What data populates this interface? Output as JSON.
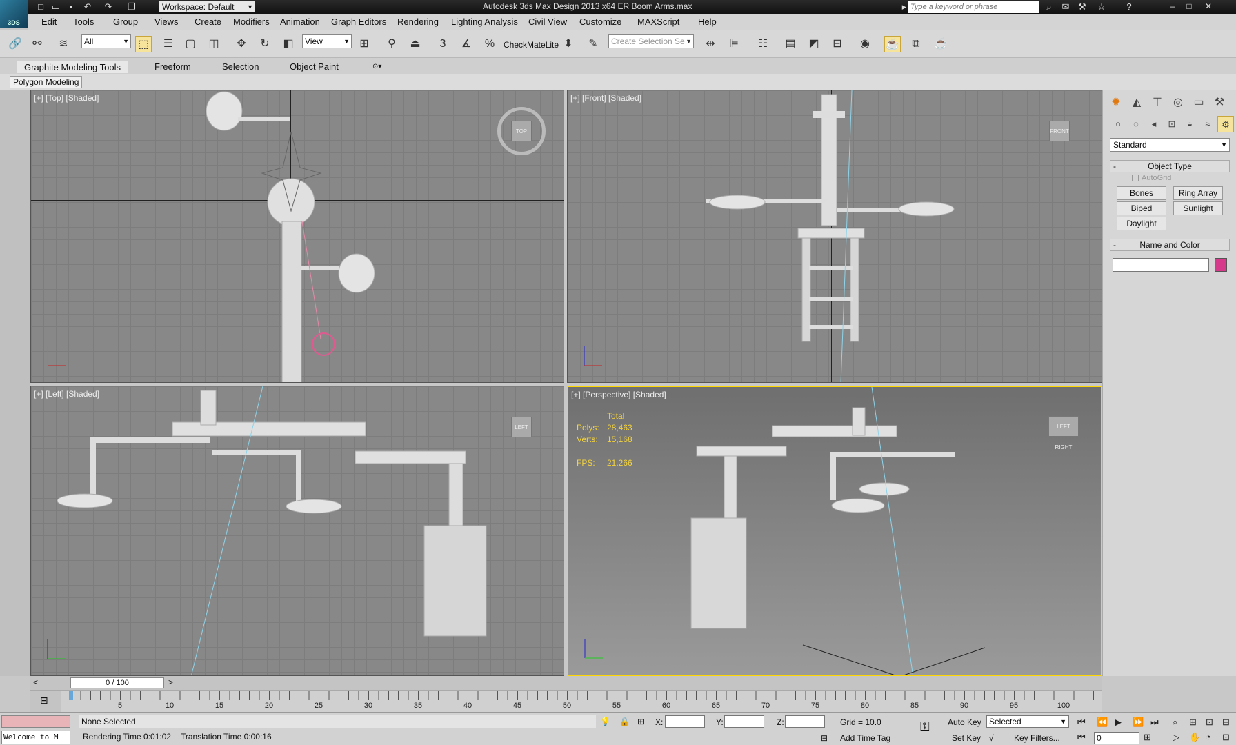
{
  "title_bar": {
    "workspace": "Workspace: Default",
    "window_title": "Autodesk 3ds Max Design 2013 x64     ER Boom Arms.max",
    "search_placeholder": "Type a keyword or phrase",
    "app_logo": "3DS"
  },
  "menu": [
    "Edit",
    "Tools",
    "Group",
    "Views",
    "Create",
    "Modifiers",
    "Animation",
    "Graph Editors",
    "Rendering",
    "Lighting Analysis",
    "Civil View",
    "Customize",
    "MAXScript",
    "Help"
  ],
  "toolbar": {
    "selection_filter": "All",
    "reference_coord": "View",
    "snap_value": "3",
    "checkmate": "CheckMateLite",
    "selection_set_placeholder": "Create Selection Se"
  },
  "ribbon": {
    "tabs": [
      "Graphite Modeling Tools",
      "Freeform",
      "Selection",
      "Object Paint"
    ],
    "panel": "Polygon Modeling"
  },
  "viewports": {
    "top": {
      "label": "[+] [Top] [Shaded]",
      "cube": "TOP"
    },
    "front": {
      "label": "[+] [Front] [Shaded]",
      "cube": "FRONT"
    },
    "left": {
      "label": "[+] [Left] [Shaded]",
      "cube": "LEFT"
    },
    "perspective": {
      "label": "[+] [Perspective] [Shaded]",
      "cube": "LEFT  RIGHT",
      "stats": {
        "header": "Total",
        "polys_label": "Polys:",
        "polys": "28,463",
        "verts_label": "Verts:",
        "verts": "15,168",
        "fps_label": "FPS:",
        "fps": "21.266"
      }
    }
  },
  "command_panel": {
    "dropdown": "Standard",
    "object_type": "Object Type",
    "autogrid": "AutoGrid",
    "buttons": [
      "Bones",
      "Ring Array",
      "Biped",
      "Sunlight",
      "Daylight"
    ],
    "name_and_color": "Name and Color",
    "swatch_color": "#d63a8a"
  },
  "timeline": {
    "position": "0 / 100",
    "ticks": [
      "5",
      "10",
      "15",
      "20",
      "25",
      "30",
      "35",
      "40",
      "45",
      "50",
      "55",
      "60",
      "65",
      "70",
      "75",
      "80",
      "85",
      "90",
      "95",
      "100"
    ]
  },
  "status": {
    "selection": "None Selected",
    "rendering_time": "Rendering Time  0:01:02",
    "translation_time": "Translation Time  0:00:16",
    "x_label": "X:",
    "y_label": "Y:",
    "z_label": "Z:",
    "grid": "Grid = 10.0",
    "add_time_tag": "Add Time Tag",
    "auto_key": "Auto Key",
    "set_key": "Set Key",
    "selected_dd": "Selected",
    "key_filters": "Key Filters...",
    "frame_field": "0",
    "maxscript": "Welcome to M"
  }
}
